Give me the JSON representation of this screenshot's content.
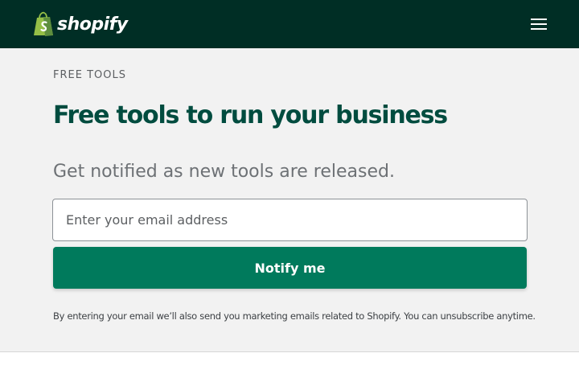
{
  "header": {
    "logo_text": "shopify",
    "logo_icon": "shopify-bag-icon",
    "menu_icon": "hamburger-menu-icon",
    "background_color": "#002e25"
  },
  "hero": {
    "eyebrow": "FREE TOOLS",
    "title": "Free tools to run your business",
    "subtitle": "Get notified as new tools are released.",
    "email_placeholder": "Enter your email address",
    "email_value": "",
    "button_label": "Notify me",
    "disclaimer": "By entering your email we’ll also send you marketing emails related to Shopify. You can unsubscribe anytime.",
    "accent_color": "#007a5c",
    "title_color": "#004c3f"
  }
}
